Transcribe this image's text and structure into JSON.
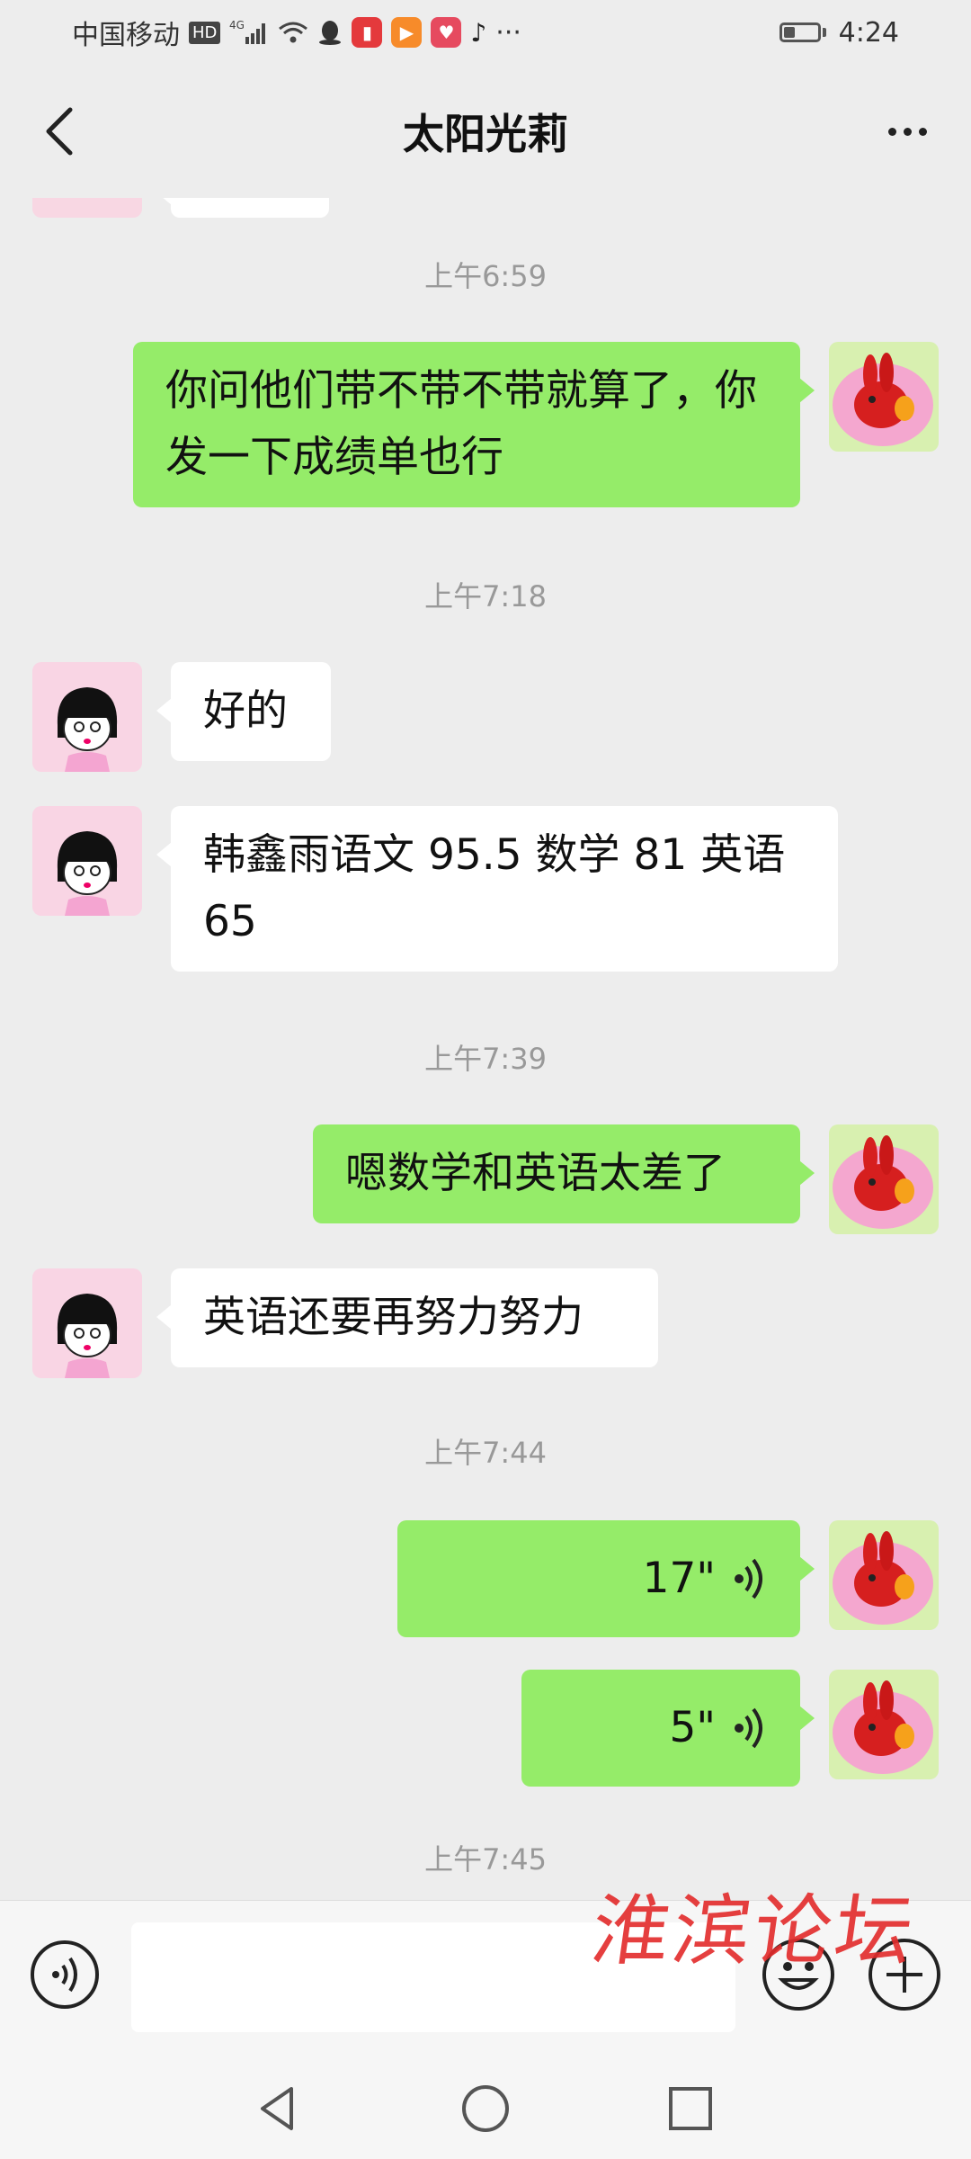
{
  "status_bar": {
    "carrier": "中国移动",
    "hd": "HD",
    "network": "4G",
    "more": "···",
    "time": "4:24"
  },
  "header": {
    "title": "太阳光莉"
  },
  "messages": [
    {
      "type": "timestamp",
      "text": "上午6:59"
    },
    {
      "type": "text",
      "from": "me",
      "text": "你问他们带不带不带就算了，你发一下成绩单也行"
    },
    {
      "type": "timestamp",
      "text": "上午7:18"
    },
    {
      "type": "text",
      "from": "them",
      "text": "好的"
    },
    {
      "type": "text",
      "from": "them",
      "text": "韩鑫雨语文 95.5 数学 81 英语 65"
    },
    {
      "type": "timestamp",
      "text": "上午7:39"
    },
    {
      "type": "text",
      "from": "me",
      "text": "嗯数学和英语太差了"
    },
    {
      "type": "text",
      "from": "them",
      "text": "英语还要再努力努力"
    },
    {
      "type": "timestamp",
      "text": "上午7:44"
    },
    {
      "type": "voice",
      "from": "me",
      "duration": "17\""
    },
    {
      "type": "voice",
      "from": "me",
      "duration": "5\""
    },
    {
      "type": "timestamp",
      "text": "上午7:45"
    }
  ],
  "input": {
    "placeholder": ""
  },
  "watermark": "淮滨论坛",
  "colors": {
    "my_bubble": "#95ec69",
    "their_bubble": "#ffffff",
    "background": "#ededed"
  }
}
